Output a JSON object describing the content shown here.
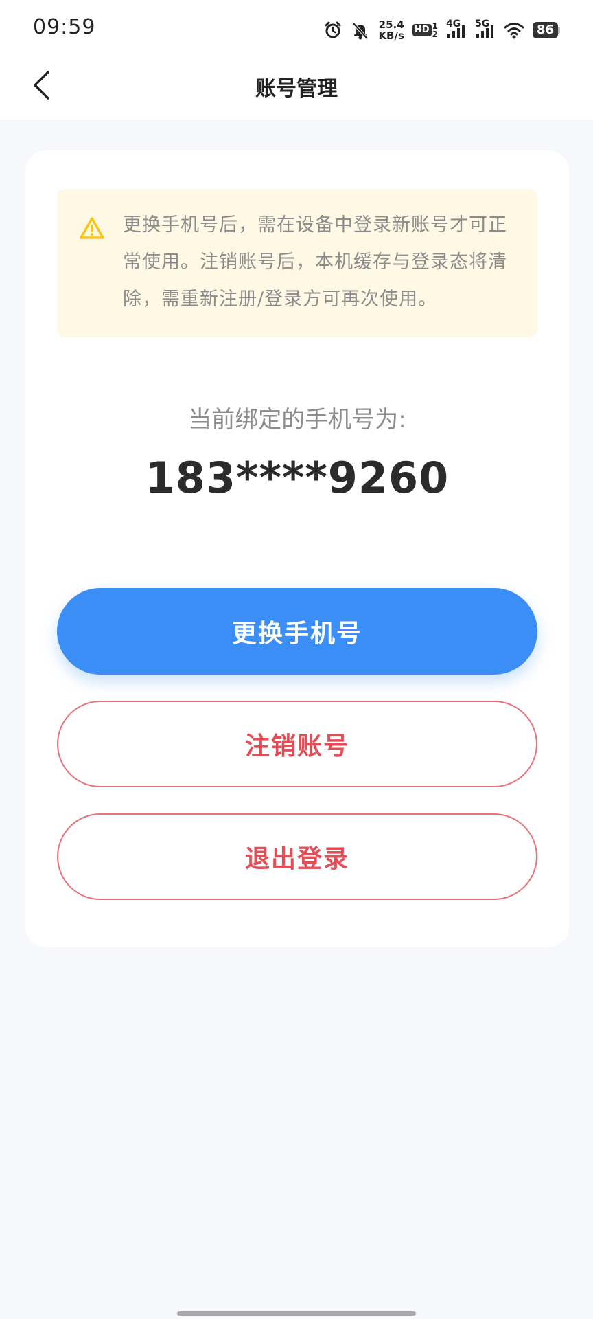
{
  "status_bar": {
    "time": "09:59",
    "net_speed_value": "25.4",
    "net_speed_unit": "KB/s",
    "hd_label": "HD",
    "hd_sup": "1",
    "hd_sub": "2",
    "net_4g": "4G",
    "net_5g": "5G",
    "battery": "86",
    "icons": [
      "alarm-icon",
      "mute-bell-icon",
      "signal-icon",
      "wifi-icon",
      "battery-icon"
    ]
  },
  "nav": {
    "title": "账号管理",
    "back_icon": "chevron-left-icon"
  },
  "notice": {
    "icon": "warning-icon",
    "text": "更换手机号后，需在设备中登录新账号才可正常使用。注销账号后，本机缓存与登录态将清除，需重新注册/登录方可再次使用。"
  },
  "account": {
    "label": "当前绑定的手机号为:",
    "phone": "183****9260"
  },
  "buttons": {
    "change_phone": "更换手机号",
    "deactivate": "注销账号",
    "logout": "退出登录"
  },
  "colors": {
    "primary": "#3a8ef6",
    "danger": "#e64c55",
    "notice_bg": "#fff8e4",
    "warning_icon": "#f5c518",
    "page_bg": "#f7f8fc"
  }
}
